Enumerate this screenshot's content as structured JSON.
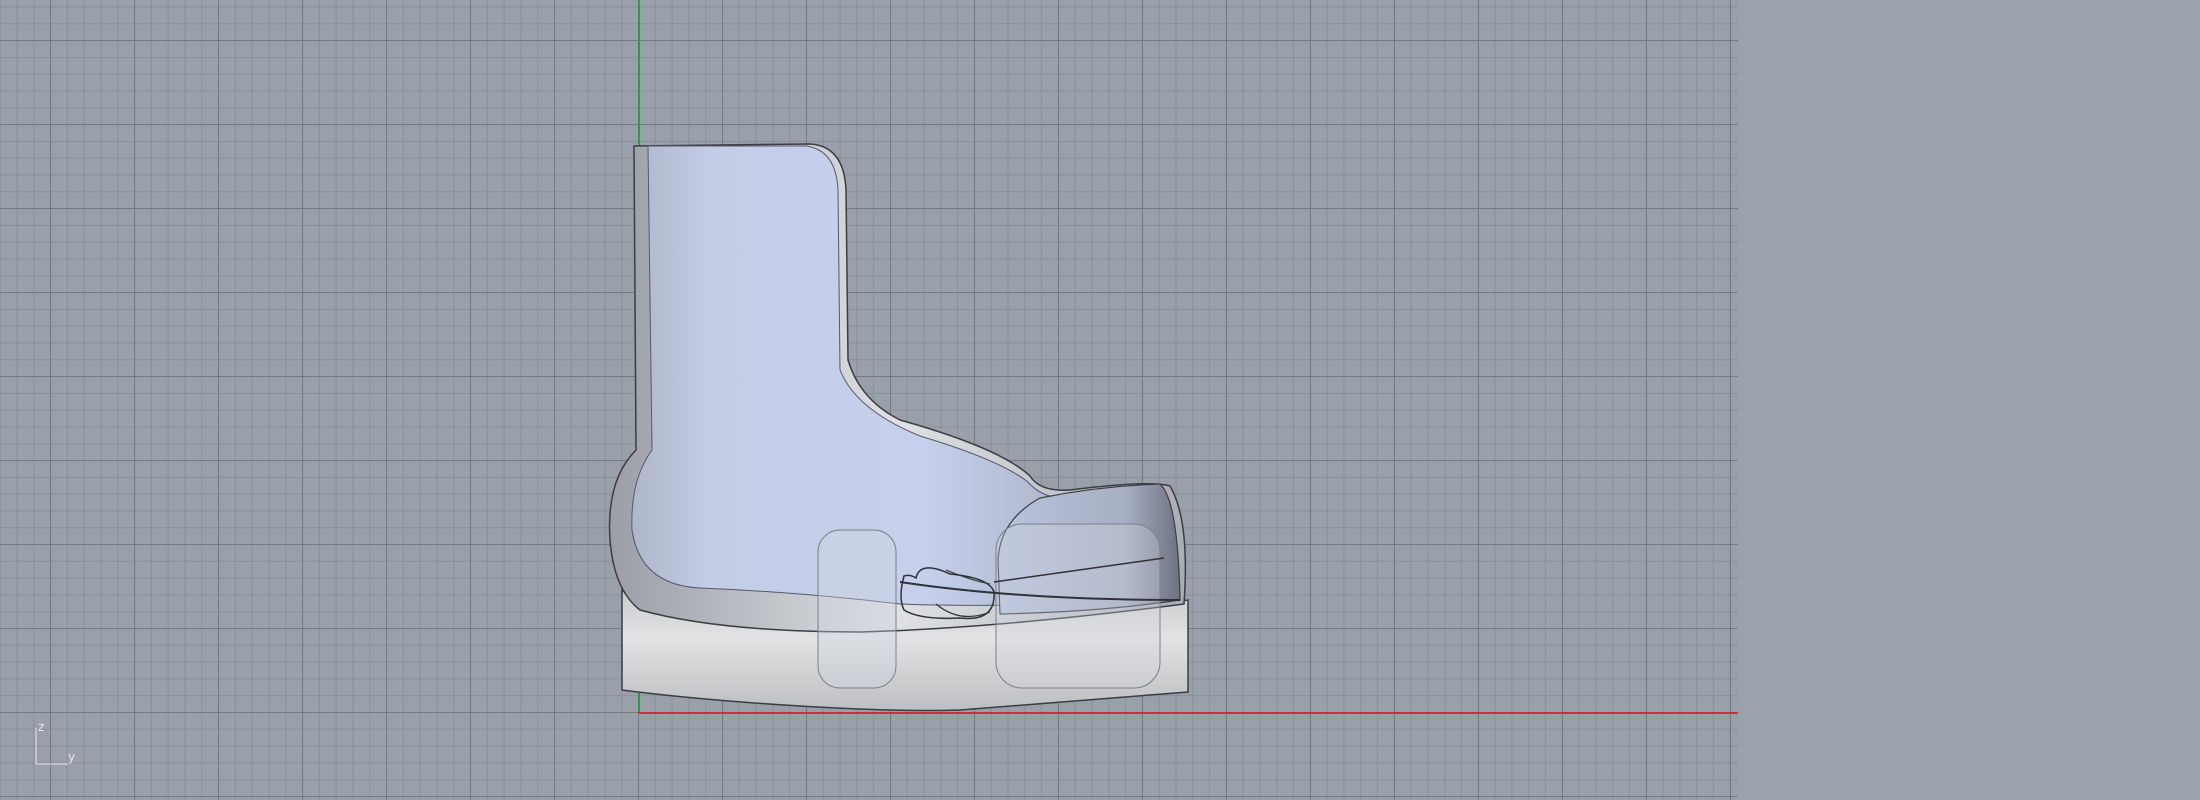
{
  "viewport": {
    "gizmo": {
      "z_label": "z",
      "y_label": "y"
    },
    "colors": {
      "background": "#99a0aa",
      "grid_major": "#707680",
      "axis_y": "#c8323a",
      "axis_z": "#2e9b45",
      "model_body": "#c3cde6",
      "model_sole": "#d8d9db"
    }
  }
}
